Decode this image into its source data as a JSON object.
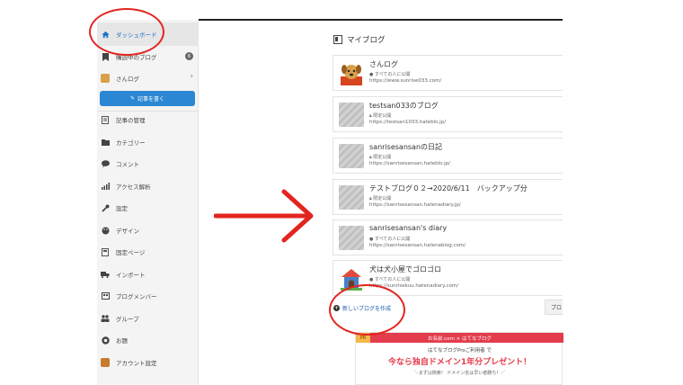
{
  "colors": {
    "accent": "#2b87d3",
    "annotation_red": "#e3241f",
    "banner_red": "#e33c4c"
  },
  "sidebar": {
    "items": [
      {
        "label": "ダッシュボード",
        "icon": "home-icon",
        "active": true
      },
      {
        "label": "購読中のブログ",
        "icon": "bookmark-icon",
        "badge": "6"
      },
      {
        "label": "さんログ",
        "icon": "dog-avatar-icon",
        "has_chevron": true
      },
      {
        "label": "記事の管理",
        "icon": "document-icon"
      },
      {
        "label": "カテゴリー",
        "icon": "folder-icon"
      },
      {
        "label": "コメント",
        "icon": "comment-icon"
      },
      {
        "label": "アクセス解析",
        "icon": "bar-chart-icon"
      },
      {
        "label": "設定",
        "icon": "wrench-icon"
      },
      {
        "label": "デザイン",
        "icon": "palette-icon"
      },
      {
        "label": "固定ページ",
        "icon": "page-icon"
      },
      {
        "label": "インポート",
        "icon": "truck-icon"
      },
      {
        "label": "ブログメンバー",
        "icon": "members-icon"
      },
      {
        "label": "グループ",
        "icon": "group-icon"
      },
      {
        "label": "お題",
        "icon": "odai-icon"
      },
      {
        "label": "アカウント設定",
        "icon": "account-icon"
      }
    ],
    "write_button": "記事を書く"
  },
  "main": {
    "title": "マイブログ",
    "blogs": [
      {
        "name": "さんログ",
        "visibility": "すべての人に公開",
        "url": "https://www.sunrise033.com/",
        "thumb": "dog"
      },
      {
        "name": "testsan033のブログ",
        "visibility": "限定公開",
        "url": "https://testsan1033.hateblo.jp/",
        "thumb": "placeholder"
      },
      {
        "name": "sanrisesansanの日記",
        "visibility": "限定公開",
        "url": "https://sanrisesansan.hateblo.jp/",
        "thumb": "placeholder"
      },
      {
        "name": "テストブログ０２→2020/6/11　バックアップ分",
        "visibility": "限定公開",
        "url": "https://sanrisesansan.hatenadiary.jp/",
        "thumb": "placeholder"
      },
      {
        "name": "sanrisesansan's diary",
        "visibility": "すべての人に公開",
        "url": "https://sanrisesansan.hatenablog.com/",
        "thumb": "placeholder"
      },
      {
        "name": "犬は犬小屋でゴロゴロ",
        "visibility": "すべての人に公開",
        "url": "https://sunrisekuu.hatenadiary.com/",
        "thumb": "house"
      }
    ],
    "new_blog": "新しいブログを作成",
    "pro_button": "プロ"
  },
  "banner": {
    "tag": "PR",
    "header": "お名前.com × はてなブログ",
    "sub": "はてなブログProご利用者 で",
    "main": "今なら独自ドメイン1年分プレゼント！",
    "foot": "＼まずは検索！ ドメイン名は早い者勝ち！／"
  }
}
